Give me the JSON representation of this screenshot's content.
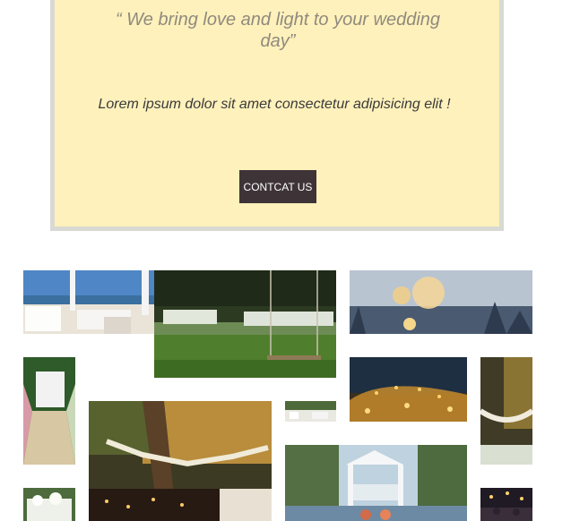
{
  "hero": {
    "quote": "“ We bring love and light to your wedding day”",
    "body": "Lorem ipsum dolor sit amet consectetur adipisicing elit !",
    "button_label": "CONTCAT US"
  },
  "gallery": {
    "photos": [
      "beach-chairs-photo",
      "tree-swing-photo",
      "bokeh-lights-photo",
      "floral-arch-aisle-photo",
      "string-lights-photo",
      "fairy-lights-photo",
      "garden-aisle-photo",
      "tree-bunting-photo",
      "white-gazebo-photo",
      "tree-garland-photo",
      "centerpiece-photo",
      "night-party-photo"
    ]
  }
}
